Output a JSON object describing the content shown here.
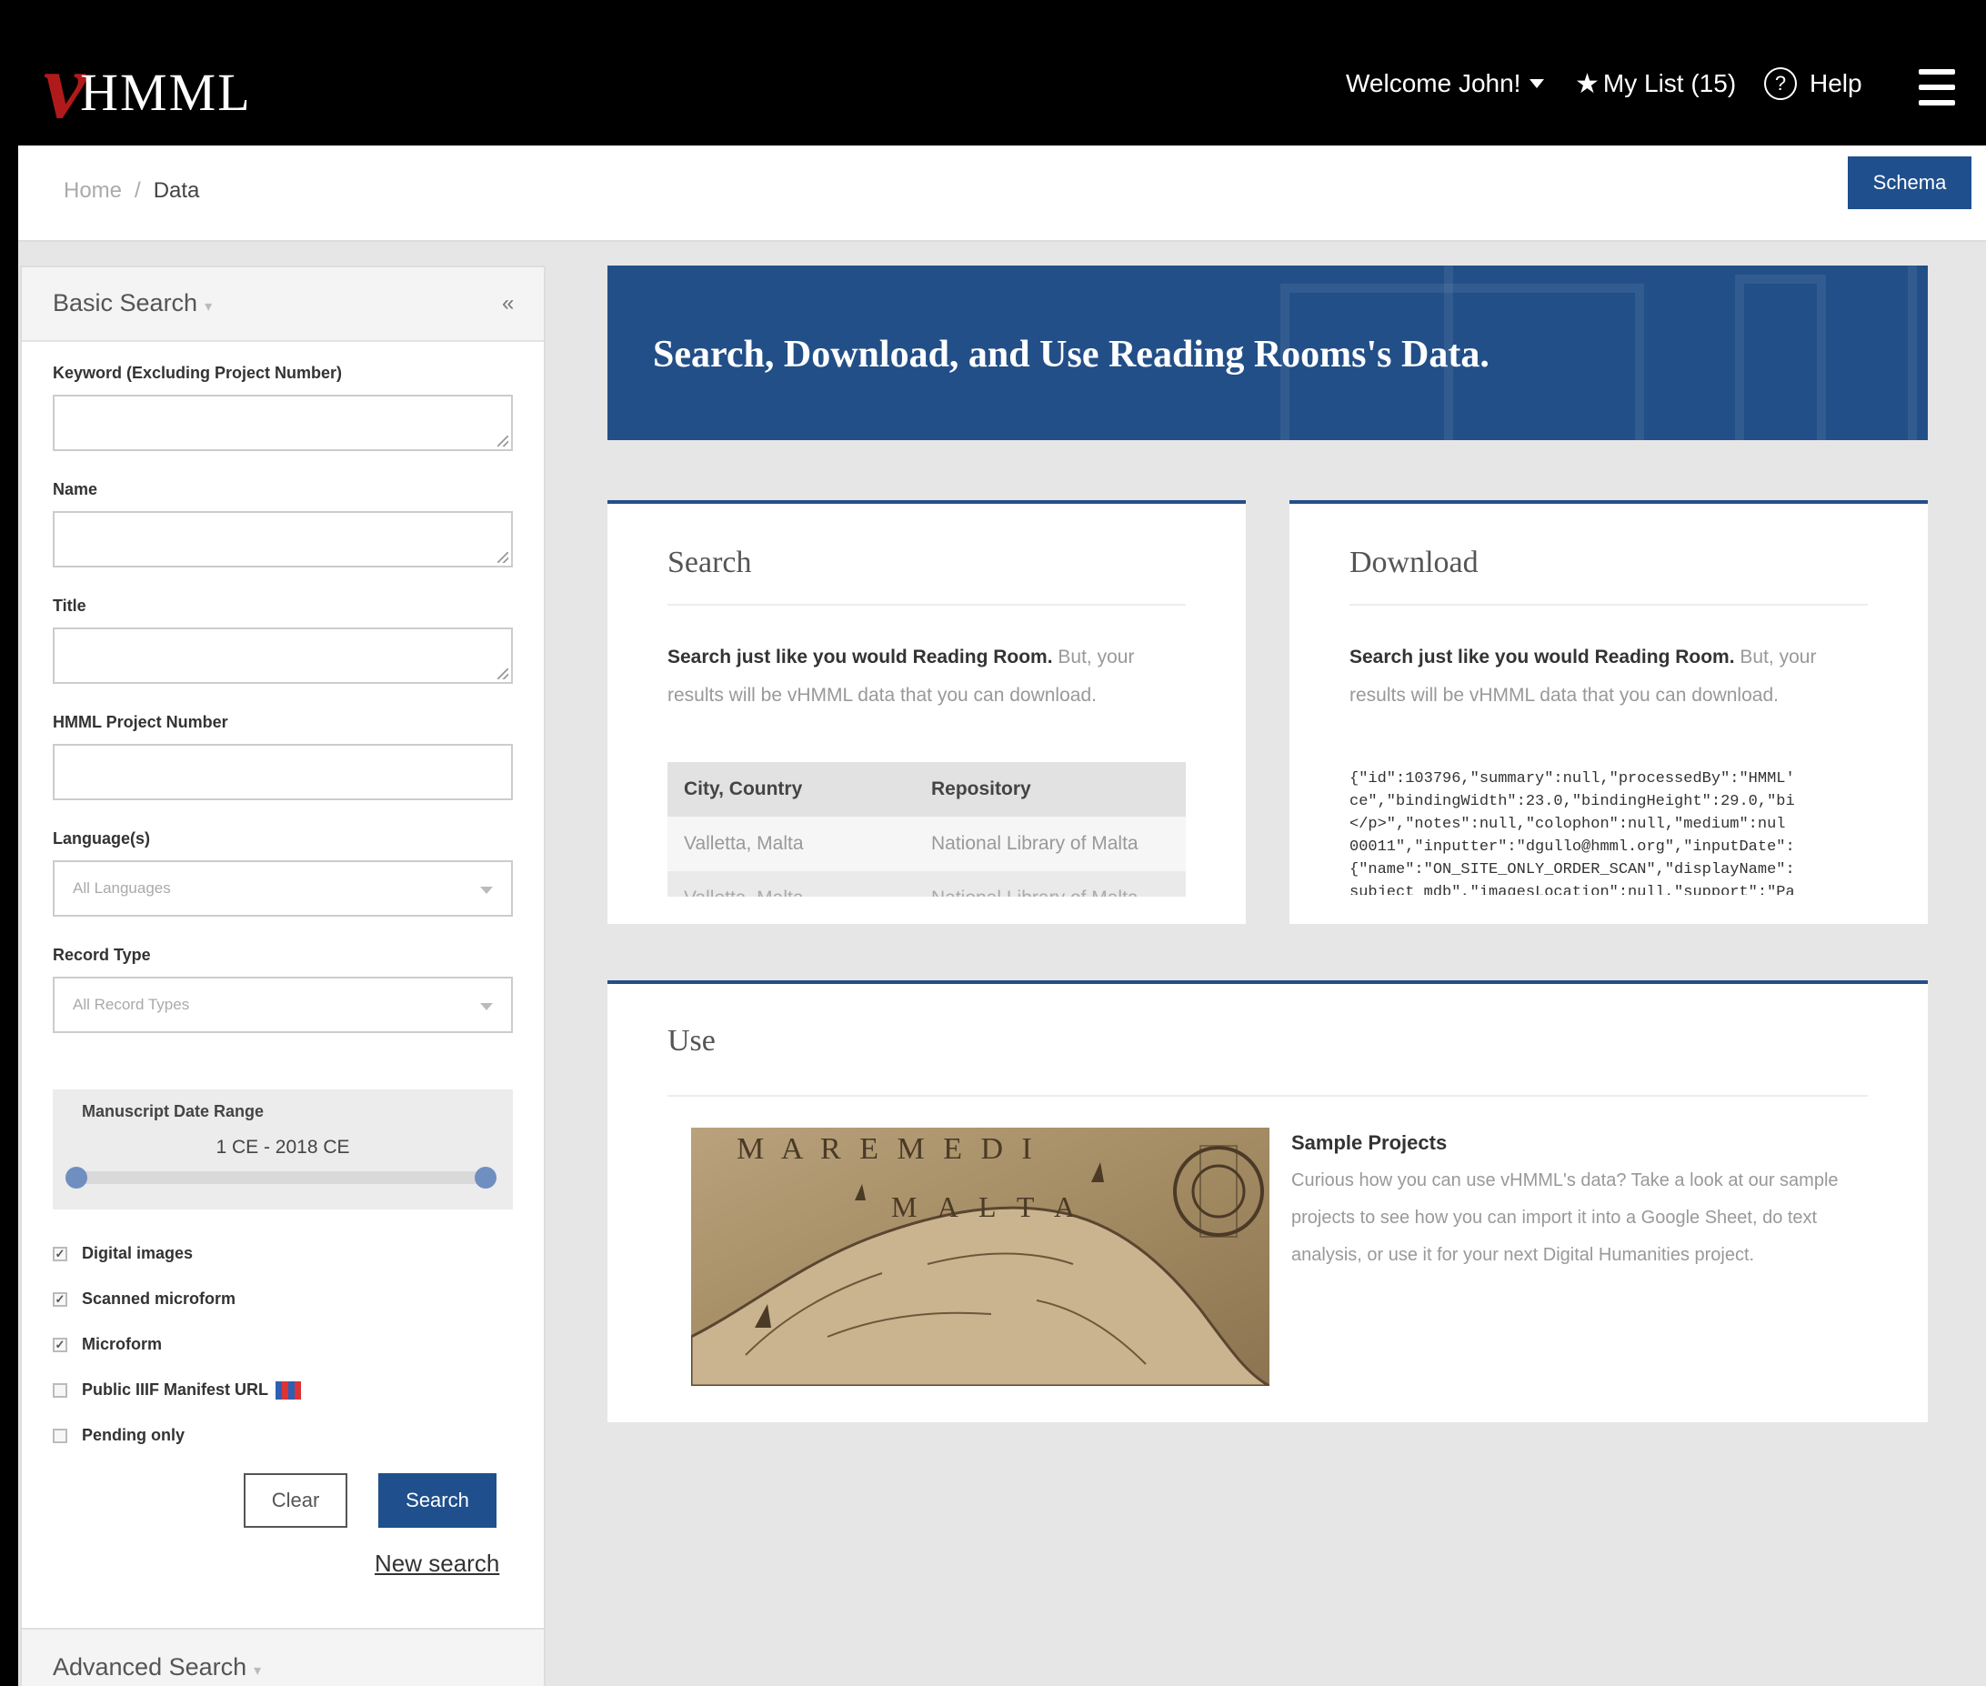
{
  "header": {
    "logo_v": "v",
    "logo_text": "HMML",
    "welcome": "Welcome John!",
    "my_list": "My List (15)",
    "help": "Help",
    "help_icon_glyph": "?",
    "star_glyph": "★"
  },
  "breadcrumb": {
    "home": "Home",
    "separator": "/",
    "current": "Data"
  },
  "schema_button": "Schema",
  "sidebar": {
    "basic_search_title": "Basic Search",
    "toggle_glyph": "▾",
    "collapse_glyph": "«",
    "keyword_label": "Keyword (Excluding Project Number)",
    "name_label": "Name",
    "title_label": "Title",
    "project_number_label": "HMML Project Number",
    "language_label": "Language(s)",
    "language_placeholder": "All Languages",
    "record_type_label": "Record Type",
    "record_type_placeholder": "All Record Types",
    "date_range_label": "Manuscript Date Range",
    "date_range_value": "1 CE - 2018 CE",
    "date_range_fraction": {
      "low": 0,
      "high": 1
    },
    "checkboxes": [
      {
        "label": "Digital images",
        "checked": true
      },
      {
        "label": "Scanned microform",
        "checked": true
      },
      {
        "label": "Microform",
        "checked": true
      },
      {
        "label": "Public IIIF Manifest URL",
        "checked": false
      },
      {
        "label": "Pending only",
        "checked": false
      }
    ],
    "check_glyph": "✓",
    "clear_button": "Clear",
    "search_button": "Search",
    "new_search": "New search",
    "advanced_search_title": "Advanced Search"
  },
  "banner": {
    "title": "Search, Download, and Use Reading Rooms's Data."
  },
  "search_card": {
    "title": "Search",
    "text_bold": "Search just like you would Reading Room.",
    "text_rest": " But, your results will be vHMML data that you can download.",
    "table_headers": [
      "City, Country",
      "Repository"
    ],
    "table_rows": [
      [
        "Valletta, Malta",
        "National Library of Malta"
      ],
      [
        "Valletta, Malta",
        "National Library of Malta"
      ]
    ]
  },
  "download_card": {
    "title": "Download",
    "text_bold": "Search just like you would Reading Room.",
    "text_rest": " But, your results will be vHMML data that you can download.",
    "json_preview": "{\"id\":103796,\"summary\":null,\"processedBy\":\"HMML'\nce\",\"bindingWidth\":23.0,\"bindingHeight\":29.0,\"bi\n</p>\",\"notes\":null,\"colophon\":null,\"medium\":nul\n00011\",\"inputter\":\"dgullo@hmml.org\",\"inputDate\":\n{\"name\":\"ON_SITE_ONLY_ORDER_SCAN\",\"displayName\":\nsubject_mdb\",\"imagesLocation\":null,\"support\":\"Pa"
  },
  "use_card": {
    "title": "Use",
    "map_text_line1": "M A R E   M E D I",
    "map_text_line2": "M A L T A",
    "sample_title": "Sample Projects",
    "sample_text": "Curious how you can use vHMML's data? Take a look at our sample projects to see how you can import it into a Google Sheet, do text analysis, or use it for your next Digital Humanities project."
  },
  "colors": {
    "navy": "#234f88",
    "button": "#1f4f8c",
    "header_bg": "#000000",
    "logo_red": "#b11a1a"
  }
}
